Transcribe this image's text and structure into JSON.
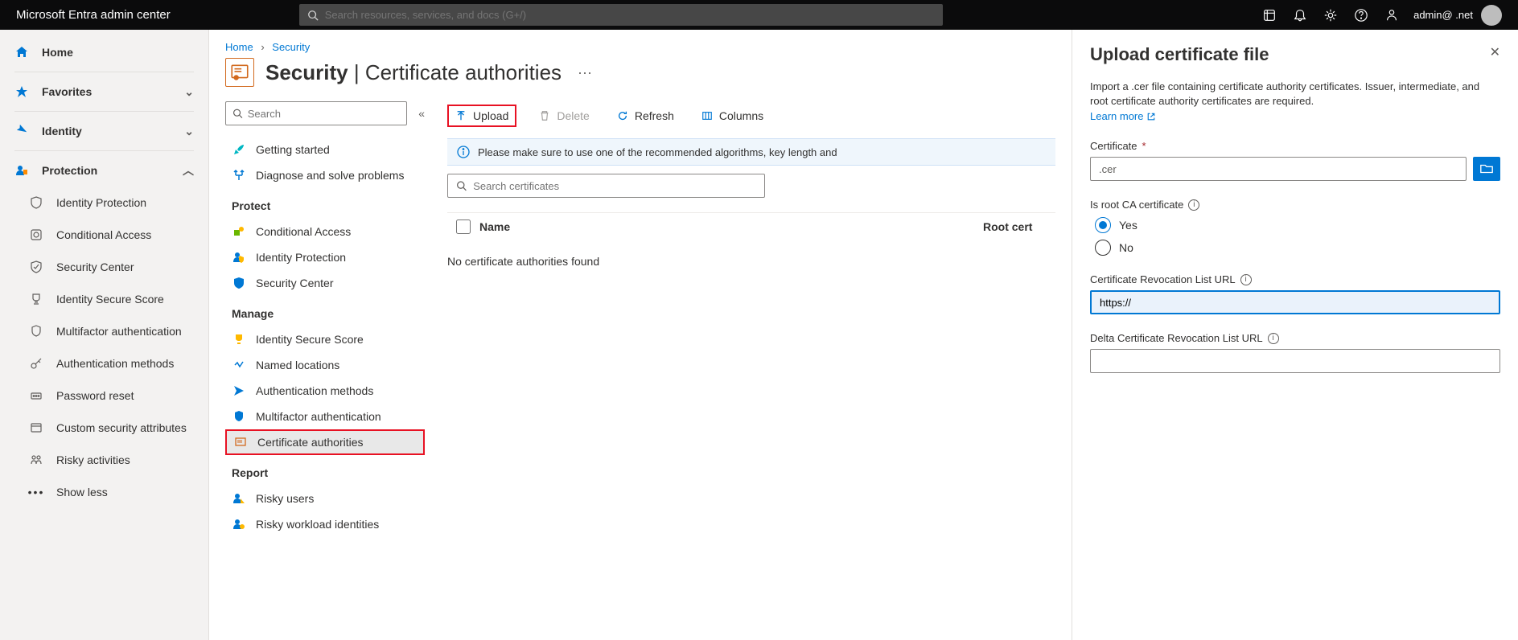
{
  "topbar": {
    "brand": "Microsoft Entra admin center",
    "search_placeholder": "Search resources, services, and docs (G+/)",
    "account": "admin@ .net"
  },
  "sidebar": {
    "home": "Home",
    "favorites": "Favorites",
    "identity": "Identity",
    "protection": "Protection",
    "protection_items": [
      "Identity Protection",
      "Conditional Access",
      "Security Center",
      "Identity Secure Score",
      "Multifactor authentication",
      "Authentication methods",
      "Password reset",
      "Custom security attributes",
      "Risky activities"
    ],
    "show_less": "Show less"
  },
  "breadcrumb": {
    "home": "Home",
    "security": "Security"
  },
  "page": {
    "title_strong": "Security",
    "title_sep": " | ",
    "title_light": "Certificate authorities"
  },
  "subnav": {
    "search_placeholder": "Search",
    "top": [
      "Getting started",
      "Diagnose and solve problems"
    ],
    "protect_heading": "Protect",
    "protect": [
      "Conditional Access",
      "Identity Protection",
      "Security Center"
    ],
    "manage_heading": "Manage",
    "manage": [
      "Identity Secure Score",
      "Named locations",
      "Authentication methods",
      "Multifactor authentication",
      "Certificate authorities"
    ],
    "report_heading": "Report",
    "report": [
      "Risky users",
      "Risky workload identities"
    ]
  },
  "toolbar": {
    "upload": "Upload",
    "delete": "Delete",
    "refresh": "Refresh",
    "columns": "Columns"
  },
  "banner": "Please make sure to use one of the recommended algorithms, key length and",
  "cert_search_placeholder": "Search certificates",
  "table": {
    "name": "Name",
    "root": "Root cert",
    "empty": "No certificate authorities found"
  },
  "flyout": {
    "title": "Upload certificate file",
    "desc": "Import a .cer file containing certificate authority certificates. Issuer, intermediate, and root certificate authority certificates are required.",
    "learn": "Learn more",
    "cert_label": "Certificate",
    "cert_value": ".cer",
    "root_label": "Is root CA certificate",
    "yes": "Yes",
    "no": "No",
    "crl_label": "Certificate Revocation List URL",
    "crl_value": "https://",
    "delta_label": "Delta Certificate Revocation List URL"
  }
}
